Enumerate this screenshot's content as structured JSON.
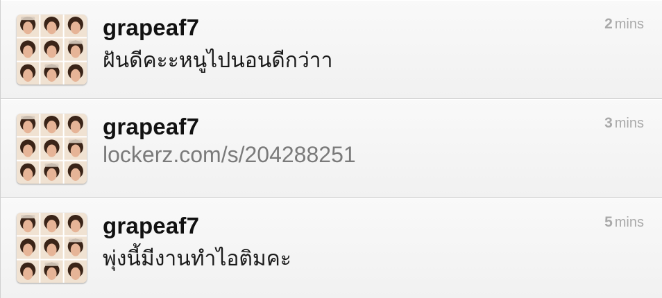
{
  "tweets": [
    {
      "username": "grapeaf7",
      "message": "ฝันดีคะะหนูไปนอนดีกว่าา",
      "is_link": false,
      "time_value": "2",
      "time_unit": "mins"
    },
    {
      "username": "grapeaf7",
      "message": "lockerz.com/s/204288251",
      "is_link": true,
      "time_value": "3",
      "time_unit": "mins"
    },
    {
      "username": "grapeaf7",
      "message": "พุ่งนี้มีงานทำไอติมคะ",
      "is_link": false,
      "time_value": "5",
      "time_unit": "mins"
    }
  ]
}
